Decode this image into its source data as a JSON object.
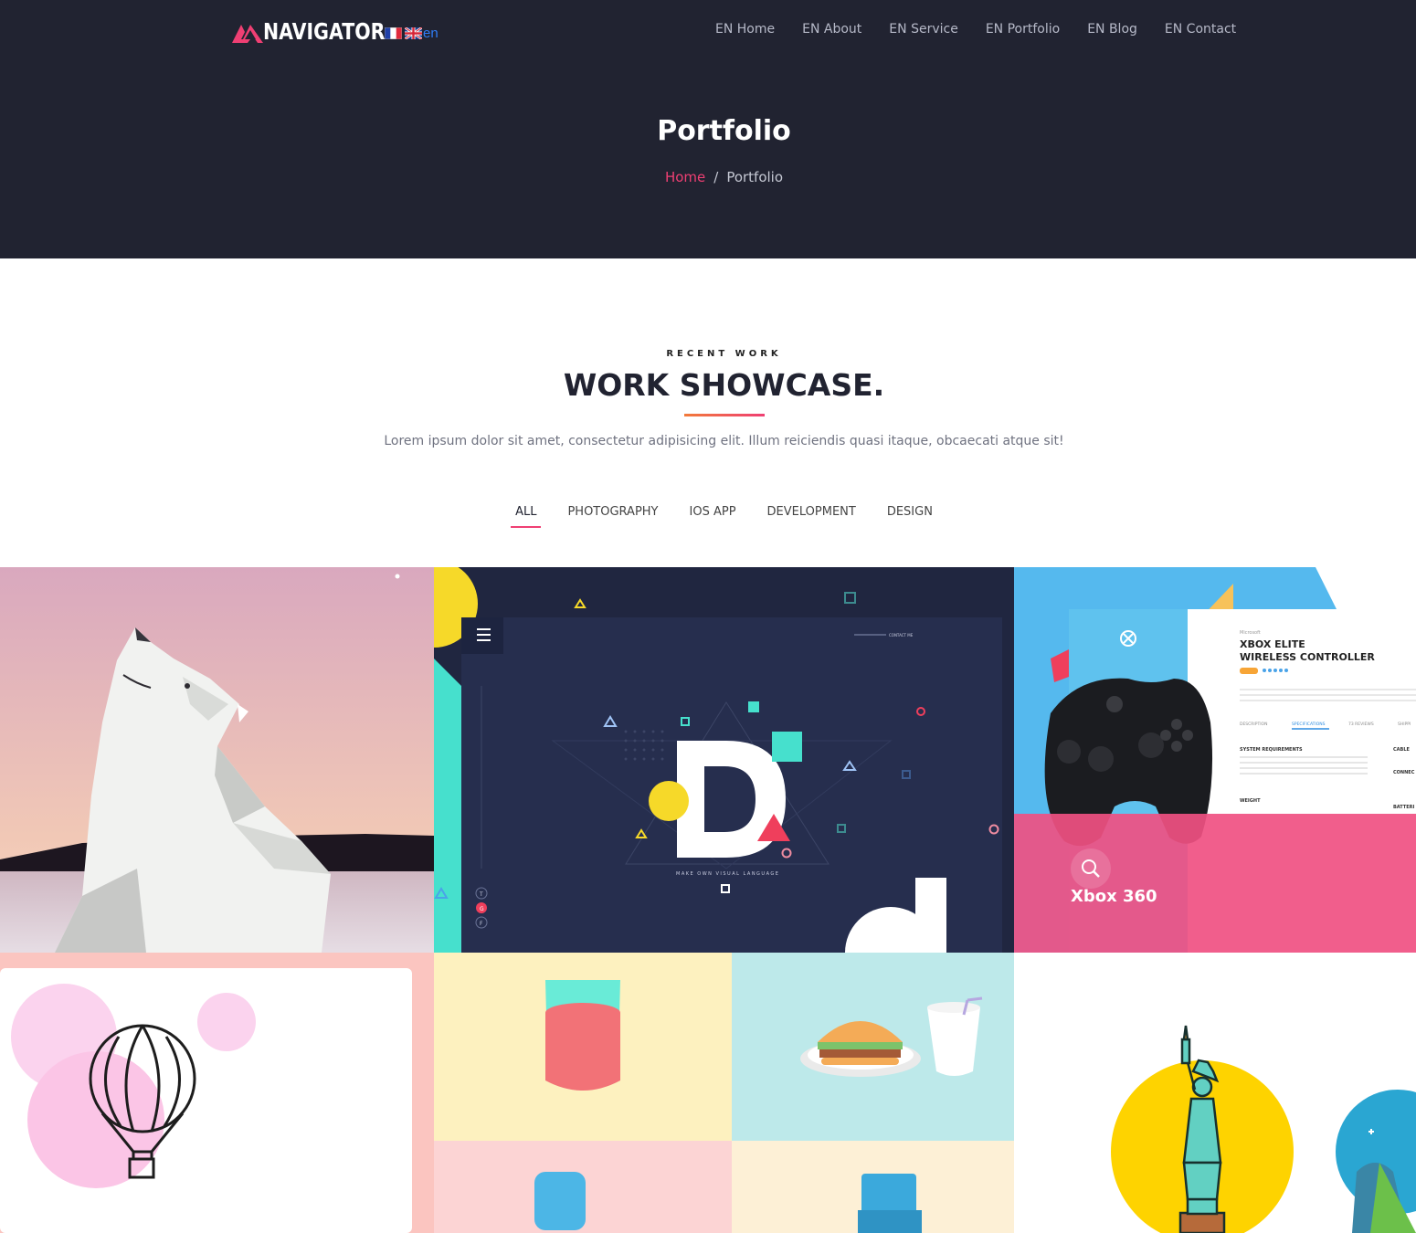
{
  "brand": {
    "name": "NAVIGATOR",
    "lang_label": "en"
  },
  "nav": [
    {
      "label": "EN Home"
    },
    {
      "label": "EN About"
    },
    {
      "label": "EN Service"
    },
    {
      "label": "EN Portfolio"
    },
    {
      "label": "EN Blog"
    },
    {
      "label": "EN Contact"
    }
  ],
  "hero": {
    "title": "Portfolio",
    "breadcrumb": {
      "home": "Home",
      "separator": "/",
      "current": "Portfolio"
    }
  },
  "section": {
    "eyebrow": "RECENT WORK",
    "title": "WORK SHOWCASE.",
    "subtitle": "Lorem ipsum dolor sit amet, consectetur adipisicing elit. Illum reiciendis quasi itaque, obcaecati atque sit!"
  },
  "filters": [
    {
      "label": "ALL",
      "active": true
    },
    {
      "label": "PHOTOGRAPHY",
      "active": false
    },
    {
      "label": "IOS APP",
      "active": false
    },
    {
      "label": "DEVELOPMENT",
      "active": false
    },
    {
      "label": "DESIGN",
      "active": false
    }
  ],
  "portfolio": {
    "items": [
      {
        "icon": "polar-bear-illustration"
      },
      {
        "icon": "letter-d-visual-language",
        "caption": "MAKE OWN VISUAL LANGUAGE",
        "contact": "CONTACT ME",
        "side_letters": [
          "T",
          "G",
          "F"
        ]
      },
      {
        "title": "Xbox 360",
        "overlay_icon": "search-icon",
        "card": {
          "brand": "Microsoft",
          "title_line1": "XBOX ELITE",
          "title_line2": "WIRELESS CONTROLLER",
          "tabs": [
            "DESCRIPTION",
            "SPECIFICATIONS",
            "73 REVIEWS",
            "SHIPPI"
          ],
          "spec1": "SYSTEM REQUIREMENTS",
          "spec2": "WEIGHT",
          "spec3": "CABLE",
          "spec4": "CONNEC",
          "spec5": "BATTERI"
        }
      },
      {
        "icon": "hot-air-balloon-icon"
      },
      {
        "icon": "food-and-drink-illustration"
      },
      {
        "icon": "statue-of-liberty-icon"
      }
    ]
  },
  "colors": {
    "hero_bg": "#212331",
    "accent": "#ef3f73",
    "gradient_start": "#f27a3a"
  }
}
